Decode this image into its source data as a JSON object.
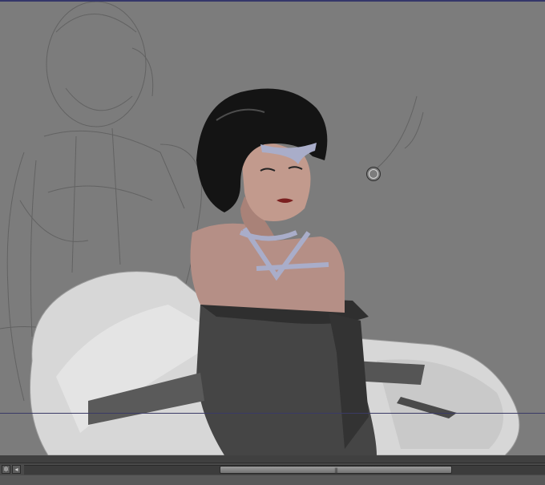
{
  "app": {
    "view": "canvas",
    "accent": "#35376a"
  },
  "toolbar": {
    "navigator_icon": "navigator-settings-icon",
    "left_arrow_icon": "scroll-left-icon"
  },
  "scrollbar": {
    "grip_glyph": "|||"
  }
}
